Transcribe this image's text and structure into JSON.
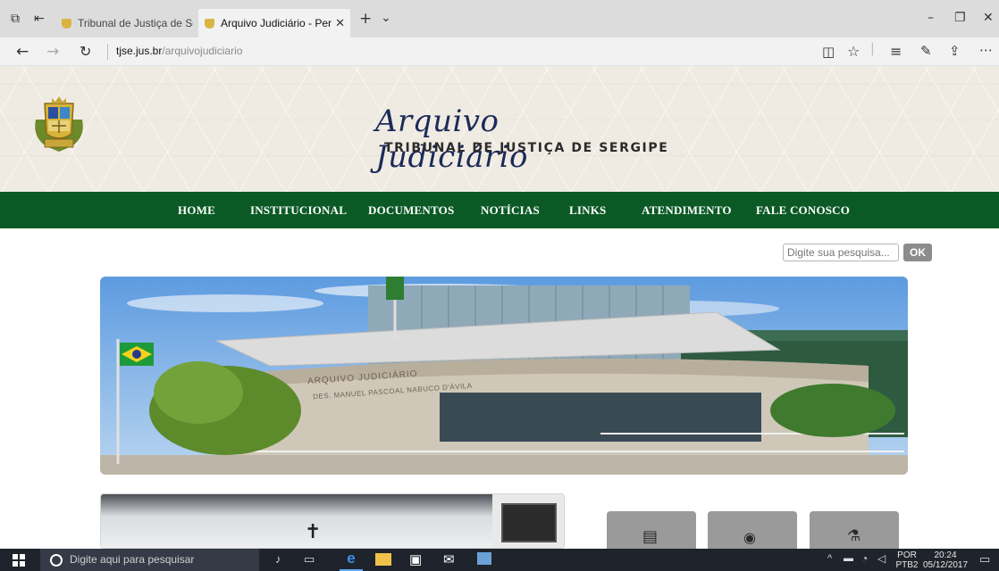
{
  "browser": {
    "tabs": [
      {
        "title": "Tribunal de Justiça de Sergip",
        "active": false
      },
      {
        "title": "Arquivo Judiciário - Perç",
        "active": true
      }
    ],
    "new_tab_glyph": "+",
    "url": {
      "domain": "tjse.jus.br",
      "path": "/arquivojudiciario"
    }
  },
  "site": {
    "title": "Arquivo Judiciário",
    "subtitle": "TRIBUNAL DE JUSTIÇA DE SERGIPE",
    "nav": [
      "HOME",
      "INSTITUCIONAL",
      "DOCUMENTOS",
      "NOTÍCIAS",
      "LINKS",
      "ATENDIMENTO",
      "FALE CONOSCO"
    ],
    "search": {
      "placeholder": "Digite sua pesquisa...",
      "button": "OK"
    },
    "banner": {
      "sign_line1": "ARQUIVO JUDICIÁRIO",
      "sign_line2": "DES. MANUEL PASCOAL NABUCO D'ÁVILA"
    }
  },
  "taskbar": {
    "search_placeholder": "Digite aqui para pesquisar",
    "lang_top": "POR",
    "lang_bottom": "PTB2",
    "time": "20:24",
    "date": "05/12/2017"
  },
  "colors": {
    "nav_green": "#0b5a25",
    "header_bg": "#efebe2",
    "title_navy": "#1c2a5a"
  },
  "icons": [
    "tab-actions-icon",
    "set-aside-icon",
    "back-icon",
    "forward-icon",
    "refresh-icon",
    "reading-view-icon",
    "favorites-icon",
    "hub-icon",
    "notes-icon",
    "share-icon",
    "more-icon",
    "minimize-icon",
    "maximize-icon",
    "close-icon",
    "windows-start-icon",
    "cortana-icon",
    "microphone-icon",
    "task-view-icon",
    "edge-icon",
    "file-explorer-icon",
    "store-icon",
    "mail-icon",
    "photos-icon",
    "book-icon",
    "camera-icon",
    "microscope-icon"
  ]
}
